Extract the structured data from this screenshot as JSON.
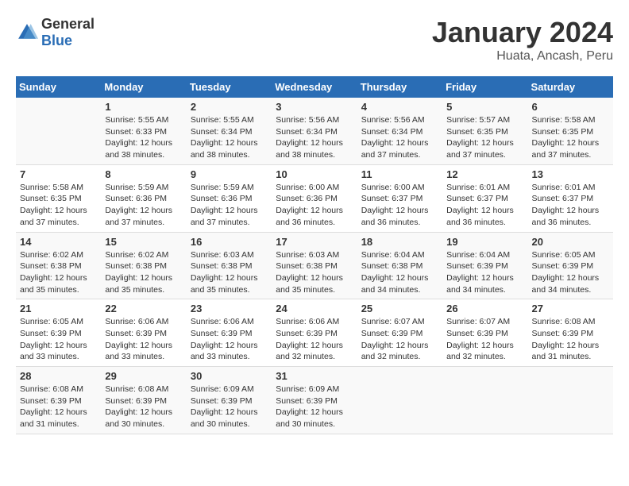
{
  "logo": {
    "general": "General",
    "blue": "Blue"
  },
  "title": "January 2024",
  "subtitle": "Huata, Ancash, Peru",
  "days_of_week": [
    "Sunday",
    "Monday",
    "Tuesday",
    "Wednesday",
    "Thursday",
    "Friday",
    "Saturday"
  ],
  "weeks": [
    [
      {
        "num": "",
        "info": ""
      },
      {
        "num": "1",
        "info": "Sunrise: 5:55 AM\nSunset: 6:33 PM\nDaylight: 12 hours and 38 minutes."
      },
      {
        "num": "2",
        "info": "Sunrise: 5:55 AM\nSunset: 6:34 PM\nDaylight: 12 hours and 38 minutes."
      },
      {
        "num": "3",
        "info": "Sunrise: 5:56 AM\nSunset: 6:34 PM\nDaylight: 12 hours and 38 minutes."
      },
      {
        "num": "4",
        "info": "Sunrise: 5:56 AM\nSunset: 6:34 PM\nDaylight: 12 hours and 37 minutes."
      },
      {
        "num": "5",
        "info": "Sunrise: 5:57 AM\nSunset: 6:35 PM\nDaylight: 12 hours and 37 minutes."
      },
      {
        "num": "6",
        "info": "Sunrise: 5:58 AM\nSunset: 6:35 PM\nDaylight: 12 hours and 37 minutes."
      }
    ],
    [
      {
        "num": "7",
        "info": "Sunrise: 5:58 AM\nSunset: 6:35 PM\nDaylight: 12 hours and 37 minutes."
      },
      {
        "num": "8",
        "info": "Sunrise: 5:59 AM\nSunset: 6:36 PM\nDaylight: 12 hours and 37 minutes."
      },
      {
        "num": "9",
        "info": "Sunrise: 5:59 AM\nSunset: 6:36 PM\nDaylight: 12 hours and 37 minutes."
      },
      {
        "num": "10",
        "info": "Sunrise: 6:00 AM\nSunset: 6:36 PM\nDaylight: 12 hours and 36 minutes."
      },
      {
        "num": "11",
        "info": "Sunrise: 6:00 AM\nSunset: 6:37 PM\nDaylight: 12 hours and 36 minutes."
      },
      {
        "num": "12",
        "info": "Sunrise: 6:01 AM\nSunset: 6:37 PM\nDaylight: 12 hours and 36 minutes."
      },
      {
        "num": "13",
        "info": "Sunrise: 6:01 AM\nSunset: 6:37 PM\nDaylight: 12 hours and 36 minutes."
      }
    ],
    [
      {
        "num": "14",
        "info": "Sunrise: 6:02 AM\nSunset: 6:38 PM\nDaylight: 12 hours and 35 minutes."
      },
      {
        "num": "15",
        "info": "Sunrise: 6:02 AM\nSunset: 6:38 PM\nDaylight: 12 hours and 35 minutes."
      },
      {
        "num": "16",
        "info": "Sunrise: 6:03 AM\nSunset: 6:38 PM\nDaylight: 12 hours and 35 minutes."
      },
      {
        "num": "17",
        "info": "Sunrise: 6:03 AM\nSunset: 6:38 PM\nDaylight: 12 hours and 35 minutes."
      },
      {
        "num": "18",
        "info": "Sunrise: 6:04 AM\nSunset: 6:38 PM\nDaylight: 12 hours and 34 minutes."
      },
      {
        "num": "19",
        "info": "Sunrise: 6:04 AM\nSunset: 6:39 PM\nDaylight: 12 hours and 34 minutes."
      },
      {
        "num": "20",
        "info": "Sunrise: 6:05 AM\nSunset: 6:39 PM\nDaylight: 12 hours and 34 minutes."
      }
    ],
    [
      {
        "num": "21",
        "info": "Sunrise: 6:05 AM\nSunset: 6:39 PM\nDaylight: 12 hours and 33 minutes."
      },
      {
        "num": "22",
        "info": "Sunrise: 6:06 AM\nSunset: 6:39 PM\nDaylight: 12 hours and 33 minutes."
      },
      {
        "num": "23",
        "info": "Sunrise: 6:06 AM\nSunset: 6:39 PM\nDaylight: 12 hours and 33 minutes."
      },
      {
        "num": "24",
        "info": "Sunrise: 6:06 AM\nSunset: 6:39 PM\nDaylight: 12 hours and 32 minutes."
      },
      {
        "num": "25",
        "info": "Sunrise: 6:07 AM\nSunset: 6:39 PM\nDaylight: 12 hours and 32 minutes."
      },
      {
        "num": "26",
        "info": "Sunrise: 6:07 AM\nSunset: 6:39 PM\nDaylight: 12 hours and 32 minutes."
      },
      {
        "num": "27",
        "info": "Sunrise: 6:08 AM\nSunset: 6:39 PM\nDaylight: 12 hours and 31 minutes."
      }
    ],
    [
      {
        "num": "28",
        "info": "Sunrise: 6:08 AM\nSunset: 6:39 PM\nDaylight: 12 hours and 31 minutes."
      },
      {
        "num": "29",
        "info": "Sunrise: 6:08 AM\nSunset: 6:39 PM\nDaylight: 12 hours and 30 minutes."
      },
      {
        "num": "30",
        "info": "Sunrise: 6:09 AM\nSunset: 6:39 PM\nDaylight: 12 hours and 30 minutes."
      },
      {
        "num": "31",
        "info": "Sunrise: 6:09 AM\nSunset: 6:39 PM\nDaylight: 12 hours and 30 minutes."
      },
      {
        "num": "",
        "info": ""
      },
      {
        "num": "",
        "info": ""
      },
      {
        "num": "",
        "info": ""
      }
    ]
  ]
}
